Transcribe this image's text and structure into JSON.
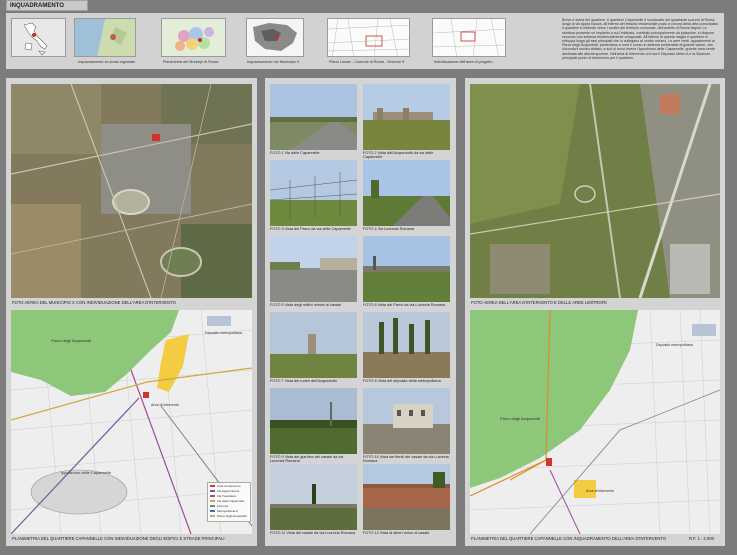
{
  "title": "INQUADRAMENTO DELL'AREA",
  "thumbs": [
    {
      "caption": ""
    },
    {
      "caption": "Inquadramento su scala regionale"
    },
    {
      "caption": "Planimetria dei Municipi di Roma"
    },
    {
      "caption": "Inquadramento nel Municipio X"
    },
    {
      "caption": "Piano Locale - Comune di Roma - Sezione 9"
    },
    {
      "caption": "Individuazione dell'area di progetto"
    }
  ],
  "description": "Breve e storia del quartiere. Il quartiere Capannelle è localizzato nel quadrante sud-est di Roma, lungo la via Appia Nuova, all'interno del tessuto residenziale posto a corona della città consolidata; il quartiere si estende verso i confini del territorio comunale, dell'ambito di Roma-Napoli. La struttura presente un impianto a cui l'edificato, costituito principalmente da palazzine, si dispone secondo uno schema tendenzialmente ortogonale. All'interno di questa maglia il quartiere si sviluppa lungo gli assi principali che lo collegano al centro urbano. Le aree verdi, appartenenti al Parco degli Acquedotti, presentano a nord e ovest un sistema ambientale di grande valore, che circonda il nucleo abitato; a sud si trova invece l'ippodromo delle Capannelle, grande area verde destinata alle attività sportive. Nell'area di intervento si trova il Deposito Metro A e la Stazione, principale punto di riferimento per il quartiere.",
  "left_top_caption": "FOTO AEREA DEL MUNICIPIO X CON INDIVIDUAZIONE DELL'AREA D'INTERVENTO",
  "left_bottom_caption": "PLANIMETRIA DEL QUARTIERE CAPANNELLE CON INDIVIDUAZIONE DEGLI EDIFICI E STRADE PRINCIPALI",
  "left_map_labels": {
    "parco": "Parco degli Acquedotti",
    "ippodromo": "Ippodromo delle Capannelle",
    "deposito": "Deposito metropolitana",
    "area": "Area di intervento"
  },
  "legend": [
    "Area di intervento",
    "Via Appia Nuova",
    "Via Tuscolana",
    "Via delle Capannelle",
    "Ferrovia",
    "Metropolitana A",
    "Parco degli Acquedotti"
  ],
  "photos": [
    {
      "caption": "FOTO 1 Via delle Capannelle"
    },
    {
      "caption": "FOTO 2 Vista dell'Acquedotto da via delle Capannelle"
    },
    {
      "caption": "FOTO 3 Vista del Parco da via delle Capannelle"
    },
    {
      "caption": "FOTO 4 Via Lucrezia Romana"
    },
    {
      "caption": "FOTO 5 Vista degli edifici minimi al casale"
    },
    {
      "caption": "FOTO 6 Vista del Parco da via Lucrezia Romana"
    },
    {
      "caption": "FOTO 7 Vista dei ruderi dell'Acquedotto"
    },
    {
      "caption": "FOTO 8 Vista del deposito della metropolitana"
    },
    {
      "caption": "FOTO 9 Vista del giardino del casale da via Lucrezia Romana"
    },
    {
      "caption": "FOTO 10 Vista dei fienili del casale da via Lucrezia Romana"
    },
    {
      "caption": "FOTO 11 Vista del casale da via Lucrezia Romana"
    },
    {
      "caption": "FOTO 12 Vista di alberi vicino al casale"
    }
  ],
  "right_top_caption": "FOTO AEREA DELL'AREA D'INTERVENTO E DELLE AREE LIMITROFE",
  "right_bottom_caption": "PLANIMETRIA DEL QUARTIERE CAPANNELLE CON INQUADRAMENTO DELL'AREA D'INTERVENTO",
  "right_map_labels": {
    "parco": "Parco degli Acquedotti",
    "deposito": "Deposito metropolitana",
    "area": "Area di intervento"
  },
  "scale": "R.F. 1 : 4.000"
}
